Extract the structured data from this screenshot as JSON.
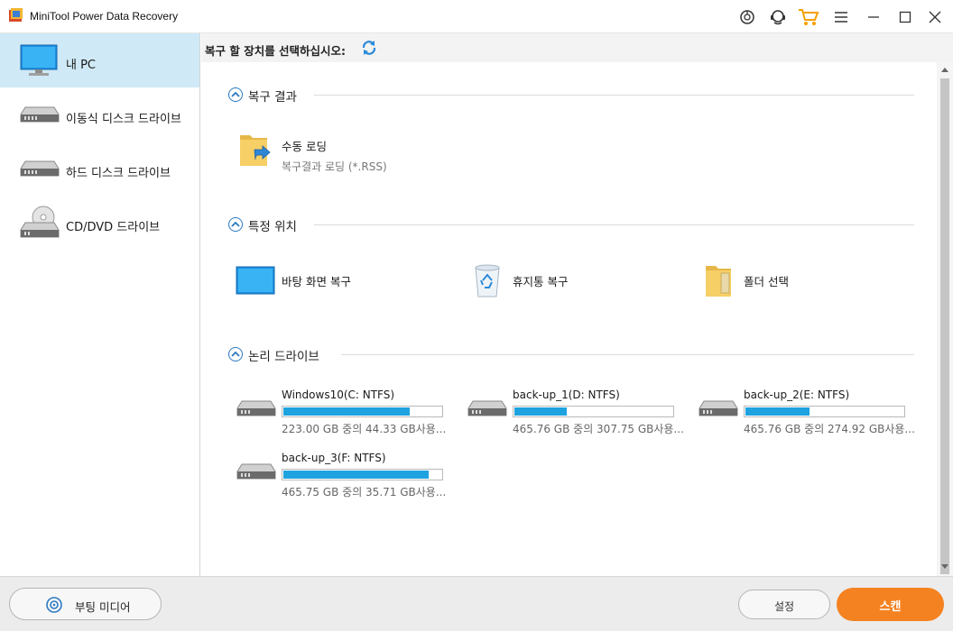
{
  "app": {
    "title": "MiniTool Power Data Recovery"
  },
  "titlebar": {
    "icons": [
      "help-circle-icon",
      "support-headset-icon",
      "cart-icon",
      "menu-icon",
      "minimize-icon",
      "maximize-icon",
      "close-icon"
    ]
  },
  "sidebar": {
    "items": [
      {
        "label": "내 PC",
        "icon": "monitor-icon",
        "active": true
      },
      {
        "label": "이동식 디스크 드라이브",
        "icon": "removable-drive-icon",
        "active": false
      },
      {
        "label": "하드 디스크 드라이브",
        "icon": "hard-drive-icon",
        "active": false
      },
      {
        "label": "CD/DVD 드라이브",
        "icon": "cd-dvd-drive-icon",
        "active": false
      }
    ]
  },
  "main": {
    "header_title": "복구 할 장치를 선택하십시오:",
    "sections": {
      "results": {
        "title": "복구 결과",
        "item_title": "수동 로딩",
        "item_sub": "복구결과 로딩 (*.RSS)"
      },
      "locations": {
        "title": "특정 위치",
        "items": [
          "바탕 화면 복구",
          "휴지통 복구",
          "폴더 선택"
        ]
      },
      "drives": {
        "title": "논리 드라이브",
        "items": [
          {
            "name": "Windows10(C: NTFS)",
            "info": "223.00 GB 중의 44.33 GB사용...",
            "used_fraction": 0.8
          },
          {
            "name": "back-up_1(D: NTFS)",
            "info": "465.76 GB 중의 307.75 GB사용...",
            "used_fraction": 0.34
          },
          {
            "name": "back-up_2(E: NTFS)",
            "info": "465.76 GB 중의 274.92 GB사용...",
            "used_fraction": 0.41
          },
          {
            "name": "back-up_3(F: NTFS)",
            "info": "465.75 GB 중의 35.71 GB사용...",
            "used_fraction": 0.92
          }
        ]
      }
    }
  },
  "bottom": {
    "boot_media_label": "부팅 미디어",
    "settings_label": "설정",
    "scan_label": "스캔"
  },
  "colors": {
    "accent": "#1ea3e0",
    "scan": "#f58220",
    "active_sidebar": "#cfe9f6"
  }
}
